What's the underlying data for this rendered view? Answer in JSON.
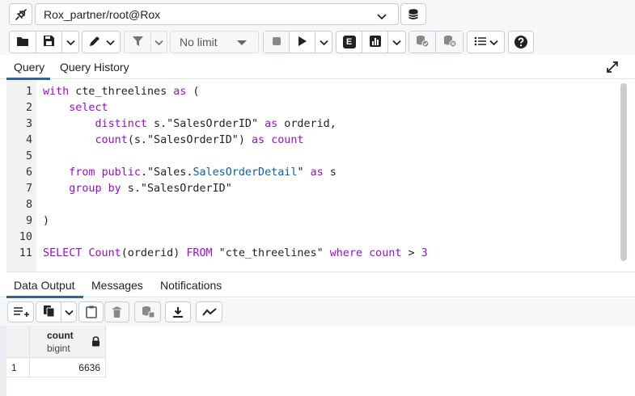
{
  "connection": {
    "label": "Rox_partner/root@Rox"
  },
  "toolbar": {
    "limit_label": "No limit",
    "explain_label": "E"
  },
  "tabs": [
    {
      "label": "Query",
      "active": true
    },
    {
      "label": "Query History",
      "active": false
    }
  ],
  "editor": {
    "lines": [
      {
        "n": "1",
        "tokens": [
          {
            "t": "with",
            "c": "kw"
          },
          {
            "t": " cte_threelines ",
            "c": "code"
          },
          {
            "t": "as",
            "c": "kw"
          },
          {
            "t": " (",
            "c": "code"
          }
        ]
      },
      {
        "n": "2",
        "tokens": [
          {
            "t": "    ",
            "c": "code"
          },
          {
            "t": "select",
            "c": "kw"
          }
        ]
      },
      {
        "n": "3",
        "tokens": [
          {
            "t": "        ",
            "c": "code"
          },
          {
            "t": "distinct",
            "c": "kw"
          },
          {
            "t": " s.\"SalesOrderID\" ",
            "c": "code"
          },
          {
            "t": "as",
            "c": "kw"
          },
          {
            "t": " orderid,",
            "c": "code"
          }
        ]
      },
      {
        "n": "4",
        "tokens": [
          {
            "t": "        ",
            "c": "code"
          },
          {
            "t": "count",
            "c": "kw"
          },
          {
            "t": "(s.\"SalesOrderID\") ",
            "c": "code"
          },
          {
            "t": "as",
            "c": "kw"
          },
          {
            "t": " ",
            "c": "code"
          },
          {
            "t": "count",
            "c": "kw"
          }
        ]
      },
      {
        "n": "5",
        "tokens": []
      },
      {
        "n": "6",
        "tokens": [
          {
            "t": "    ",
            "c": "code"
          },
          {
            "t": "from",
            "c": "kw"
          },
          {
            "t": " ",
            "c": "code"
          },
          {
            "t": "public",
            "c": "kw"
          },
          {
            "t": ".\"Sales.",
            "c": "code"
          },
          {
            "t": "SalesOrderDetail",
            "c": "pu"
          },
          {
            "t": "\" ",
            "c": "code"
          },
          {
            "t": "as",
            "c": "kw"
          },
          {
            "t": " s",
            "c": "code"
          }
        ]
      },
      {
        "n": "7",
        "tokens": [
          {
            "t": "    ",
            "c": "code"
          },
          {
            "t": "group by",
            "c": "kw"
          },
          {
            "t": " s.\"SalesOrderID\"",
            "c": "code"
          }
        ]
      },
      {
        "n": "8",
        "tokens": []
      },
      {
        "n": "9",
        "tokens": [
          {
            "t": ")",
            "c": "code"
          }
        ]
      },
      {
        "n": "10",
        "tokens": []
      },
      {
        "n": "11",
        "tokens": [
          {
            "t": "SELECT",
            "c": "kw"
          },
          {
            "t": " ",
            "c": "code"
          },
          {
            "t": "Count",
            "c": "kw"
          },
          {
            "t": "(orderid) ",
            "c": "code"
          },
          {
            "t": "FROM",
            "c": "kw"
          },
          {
            "t": " \"cte_threelines\" ",
            "c": "code"
          },
          {
            "t": "where",
            "c": "kw"
          },
          {
            "t": " ",
            "c": "code"
          },
          {
            "t": "count",
            "c": "kw"
          },
          {
            "t": " > ",
            "c": "code"
          },
          {
            "t": "3",
            "c": "kw"
          }
        ]
      }
    ]
  },
  "result_tabs": [
    {
      "label": "Data Output",
      "active": true
    },
    {
      "label": "Messages",
      "active": false
    },
    {
      "label": "Notifications",
      "active": false
    }
  ],
  "grid": {
    "column": {
      "name": "count",
      "type": "bigint"
    },
    "rows": [
      {
        "num": "1",
        "value": "6636"
      }
    ]
  },
  "colors": {
    "accent": "#326690",
    "keyword": "#9b0bd1",
    "identifier": "#0b5fa8"
  }
}
